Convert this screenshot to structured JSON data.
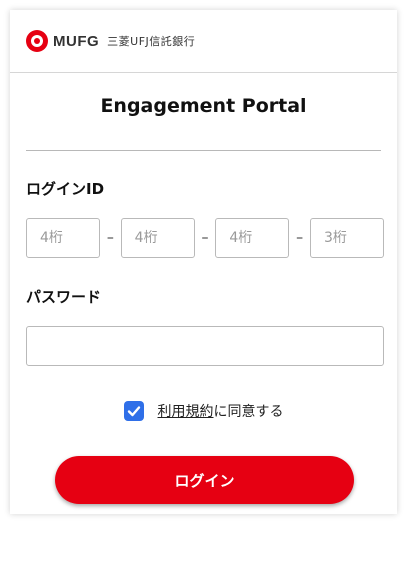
{
  "header": {
    "logo_text": "MUFG",
    "logo_subtext": "三菱UFJ信託銀行",
    "brand_color": "#e60012"
  },
  "page": {
    "title": "Engagement Portal"
  },
  "login_id": {
    "label": "ログインID",
    "fields": [
      {
        "placeholder": "4桁",
        "value": ""
      },
      {
        "placeholder": "4桁",
        "value": ""
      },
      {
        "placeholder": "4桁",
        "value": ""
      },
      {
        "placeholder": "3桁",
        "value": ""
      }
    ],
    "separator": "–"
  },
  "password": {
    "label": "パスワード",
    "value": ""
  },
  "agreement": {
    "checked": true,
    "link_text": "利用規約",
    "suffix_text": "に同意する",
    "check_color": "#2f6fe8"
  },
  "login_button": {
    "label": "ログイン",
    "color": "#e60012"
  }
}
